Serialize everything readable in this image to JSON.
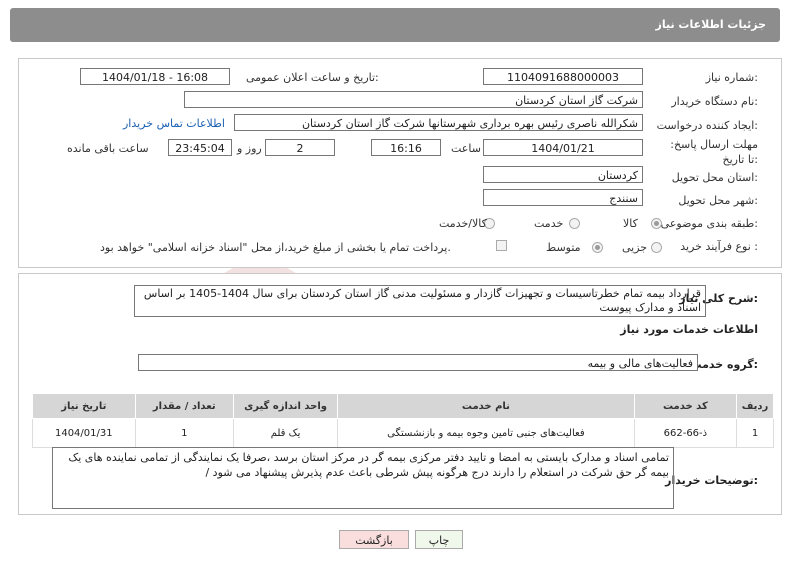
{
  "header": {
    "title": "جزئیات اطلاعات نیاز"
  },
  "fields": {
    "need_number_label": "شماره نیاز:",
    "need_number": "1104091688000003",
    "announce_label": "تاریخ و ساعت اعلان عمومی:",
    "announce_value": "1404/01/18 - 16:08",
    "buyer_org_label": "نام دستگاه خریدار:",
    "buyer_org": "شرکت گاز استان کردستان",
    "requester_label": "ایجاد کننده درخواست:",
    "requester": "شکرالله  ناصری  رئیس بهره برداری شهرستانها شرکت گاز استان کردستان",
    "contact_link": "اطلاعات تماس خریدار",
    "deadline_label": "مهلت ارسال پاسخ: تا تاریخ:",
    "deadline_date": "1404/01/21",
    "time_label": "ساعت",
    "deadline_time": "16:16",
    "days_value": "2",
    "days_label": "روز و",
    "remaining_time": "23:45:04",
    "remaining_label": "ساعت باقی مانده",
    "province_label": "استان محل تحویل:",
    "province": "کردستان",
    "city_label": "شهر محل تحویل:",
    "city": "سنندج",
    "category_label": "طبقه بندی موضوعی:",
    "category_options": [
      "کالا",
      "خدمت",
      "کالا/خدمت"
    ],
    "process_label": "نوع فرآیند خرید :",
    "process_options": [
      "جزیی",
      "متوسط"
    ],
    "payment_note": "پرداخت تمام یا بخشی از مبلغ خرید،از محل \"اسناد خزانه اسلامی\" خواهد بود."
  },
  "summary": {
    "label": "شرح کلی نیاز:",
    "text": "قرارداد بیمه تمام خطرتاسیسات و تجهیزات گازدار و مسئولیت مدنی گاز استان کردستان برای سال 1404-1405 بر اساس اسناد و مدارک پیوست"
  },
  "services": {
    "title": "اطلاعات خدمات مورد نیاز",
    "group_label": "گروه خدمت:",
    "group_value": "فعالیت‌های مالی و بیمه",
    "columns": [
      "ردیف",
      "کد خدمت",
      "نام خدمت",
      "واحد اندازه گیری",
      "تعداد / مقدار",
      "تاریخ نیاز"
    ],
    "rows": [
      [
        "1",
        "ذ-66-662",
        "فعالیت‌های جنبی تامین وجوه بیمه و بازنشستگی",
        "یک قلم",
        "1",
        "1404/01/31"
      ]
    ]
  },
  "buyer_notes": {
    "label": "توضیحات خریدار:",
    "text": "تمامی اسناد و مدارک بایستی به امضا و تایید دفتر مرکزی بیمه گر در مرکز استان برسد ،صرفا یک نمایندگی از تمامی نماینده های یک بیمه گر حق شرکت در استعلام را دارند درج هرگونه پیش شرطی باعث عدم پذیرش پیشنهاد می شود /"
  },
  "buttons": {
    "print": "چاپ",
    "back": "بازگشت"
  },
  "colors": {
    "header_bg": "#8d8d8d",
    "back_btn_bg": "#fadede",
    "print_btn_bg": "#f0f8ec",
    "link": "#1a5fb4"
  }
}
